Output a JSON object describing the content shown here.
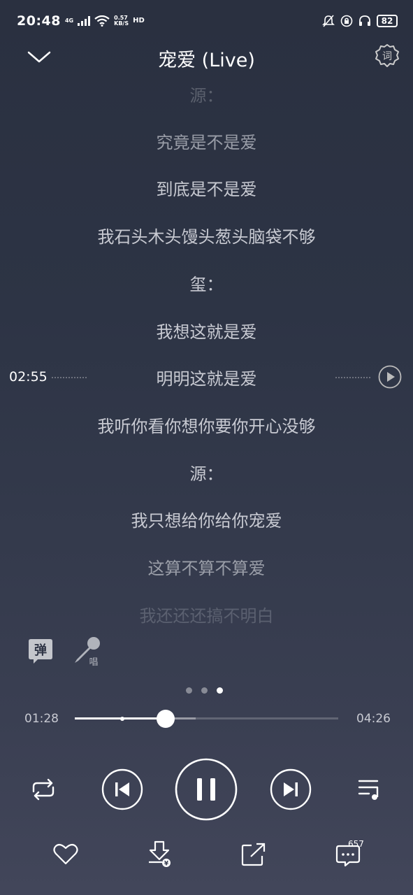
{
  "status_bar": {
    "time": "20:48",
    "network_type": "4G",
    "net_speed_value": "0.57",
    "net_speed_unit": "KB/S",
    "hd_label": "HD",
    "battery": "82"
  },
  "header": {
    "title": "宠爱 (Live)",
    "settings_icon_label": "词"
  },
  "lyrics": [
    "源：",
    "究竟是不是爱",
    "到底是不是爱",
    "我石头木头馒头葱头脑袋不够",
    "玺：",
    "我想这就是爱",
    "明明这就是爱",
    "我听你看你想你要你开心没够",
    "源：",
    "我只想给你给你宠爱",
    "这算不算不算爱",
    "我还还还搞不明白"
  ],
  "seek_preview": {
    "time": "02:55"
  },
  "tools": {
    "danmu_label": "弹",
    "sing_label": "唱"
  },
  "page_indicator": {
    "count": 3,
    "active_index": 2
  },
  "progress": {
    "current": "01:28",
    "total": "04:26",
    "played_fraction": 0.345
  },
  "comments": {
    "count": "657"
  },
  "icons": {
    "back": "chevron-down-icon",
    "settings": "lyrics-settings-icon",
    "repeat": "repeat-icon",
    "previous": "previous-icon",
    "pause": "pause-icon",
    "next": "next-icon",
    "playlist": "playlist-icon",
    "like": "heart-icon",
    "download": "download-icon",
    "share": "share-icon",
    "comment": "comment-icon"
  }
}
